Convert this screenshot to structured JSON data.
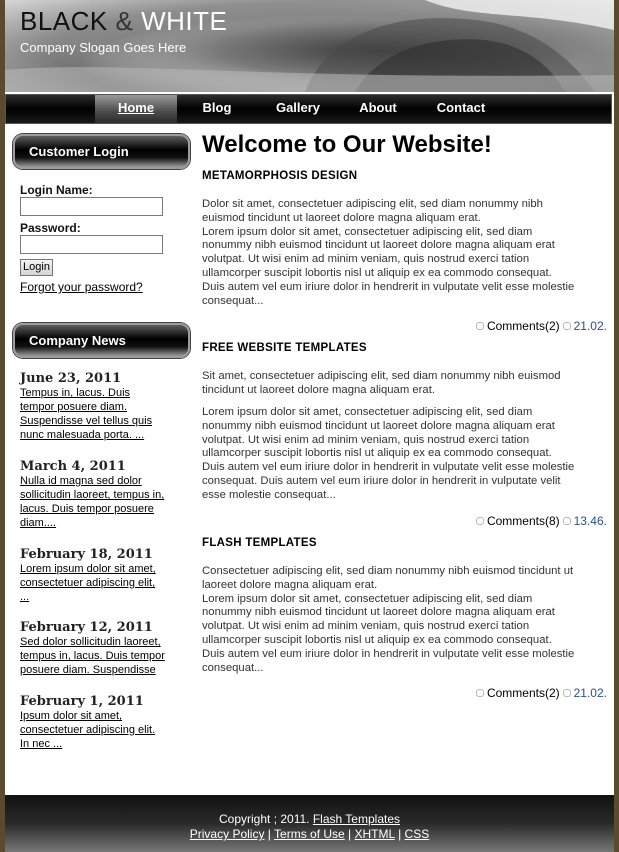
{
  "header": {
    "title_part1": "BLACK",
    "title_amp": " & ",
    "title_part2": "WHITE",
    "slogan": "Company Slogan Goes Here"
  },
  "nav": [
    "Home",
    "Blog",
    "Gallery",
    "About",
    "Contact"
  ],
  "login": {
    "title": "Customer Login",
    "name_label": "Login Name:",
    "password_label": "Password:",
    "button": "Login",
    "forgot": "Forgot your password?"
  },
  "news": {
    "title": "Company News",
    "items": [
      {
        "date": "June 23, 2011",
        "lines": [
          "Tempus in, lacus. Duis",
          "tempor posuere diam.",
          "Suspendisse vel tellus quis",
          "nunc malesuada porta. ..."
        ]
      },
      {
        "date": "March 4, 2011",
        "lines": [
          "Nulla id magna sed dolor",
          "sollicitudin laoreet, tempus in,",
          "lacus. Duis tempor posuere",
          "diam...."
        ]
      },
      {
        "date": "February 18, 2011",
        "lines": [
          "Lorem ipsum dolor sit amet,",
          "consectetuer adipiscing elit,",
          "..."
        ]
      },
      {
        "date": "February 12, 2011",
        "lines": [
          "Sed dolor sollicitudin laoreet,",
          "tempus in, lacus. Duis tempor",
          "posuere diam. Suspendisse"
        ]
      },
      {
        "date": "February 1, 2011",
        "lines": [
          "Ipsum dolor sit amet,",
          "consectetuer adipiscing elit.",
          "In nec ..."
        ]
      }
    ]
  },
  "main": {
    "heading": "Welcome to Our Website!",
    "sections": [
      {
        "title": "METAMORPHOSIS DESIGN",
        "paragraphs": [
          [
            "Dolor sit amet, consectetuer adipiscing elit, sed diam nonummy nibh",
            "euismod tincidunt ut laoreet dolore magna aliquam erat.",
            "Lorem ipsum dolor sit amet, consectetuer adipiscing elit, sed diam",
            "nonummy nibh euismod tincidunt ut laoreet dolore magna aliquam erat",
            "volutpat. Ut wisi enim ad minim veniam, quis nostrud exerci tation",
            "ullamcorper suscipit lobortis nisl ut aliquip ex ea commodo consequat.",
            "Duis autem vel eum iriure dolor in hendrerit in vulputate velit esse molestie",
            "consequat..."
          ]
        ],
        "comments": "Comments(2)",
        "date": "21.02."
      },
      {
        "title": "FREE WEBSITE TEMPLATES",
        "paragraphs": [
          [
            "Sit amet, consectetuer adipiscing elit, sed diam nonummy nibh euismod",
            "tincidunt ut laoreet dolore magna aliquam erat."
          ],
          [
            "Lorem ipsum dolor sit amet, consectetuer adipiscing elit, sed diam",
            "nonummy nibh euismod tincidunt ut laoreet dolore magna aliquam erat",
            "volutpat. Ut wisi enim ad minim veniam, quis nostrud exerci tation",
            "ullamcorper suscipit lobortis nisl ut aliquip ex ea commodo consequat.",
            "Duis autem vel eum iriure dolor in hendrerit in vulputate velit esse molestie",
            "consequat. Duis autem vel eum iriure dolor in hendrerit in vulputate velit",
            "esse molestie consequat..."
          ]
        ],
        "comments": "Comments(8)",
        "date": "13.46."
      },
      {
        "title": "FLASH TEMPLATES",
        "paragraphs": [
          [
            "Consectetuer adipiscing elit, sed diam nonummy nibh euismod tincidunt ut",
            "laoreet dolore magna aliquam erat.",
            "Lorem ipsum dolor sit amet, consectetuer adipiscing elit, sed diam",
            "nonummy nibh euismod tincidunt ut laoreet dolore magna aliquam erat",
            "volutpat. Ut wisi enim ad minim veniam, quis nostrud exerci tation",
            "ullamcorper suscipit lobortis nisl ut aliquip ex ea commodo consequat.",
            "Duis autem vel eum iriure dolor in hendrerit in vulputate velit esse molestie",
            "consequat..."
          ]
        ],
        "comments": "Comments(2)",
        "date": "21.02."
      }
    ]
  },
  "footer": {
    "copyright": "Copyright ; 2011. ",
    "copyright_link": "Flash Templates",
    "links": [
      "Privacy Policy",
      "Terms of Use",
      "XHTML",
      "CSS"
    ],
    "separator": " | "
  },
  "colors": {
    "page_border": "#5a4a2e",
    "link_date": "#2a4f8a",
    "nav_bg": "#000000"
  }
}
